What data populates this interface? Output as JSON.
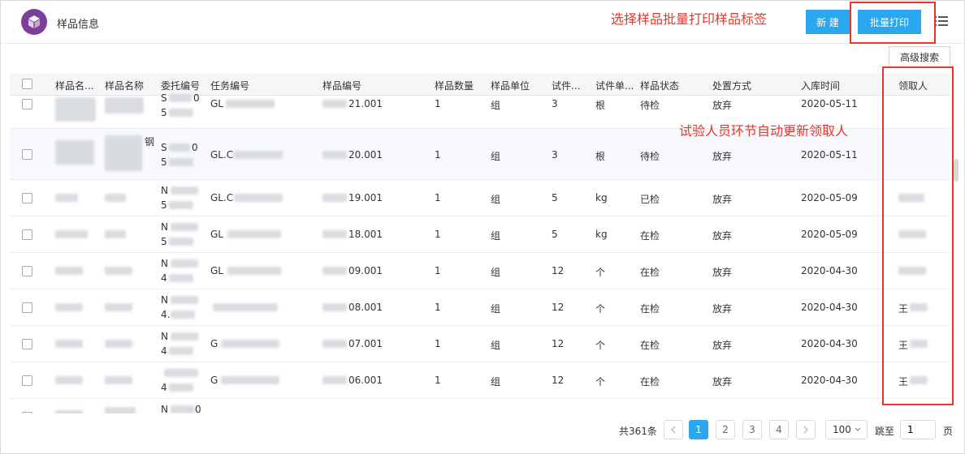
{
  "header": {
    "title": "样品信息",
    "logo_icon": "cube-icon",
    "new_label": "新 建",
    "batch_print_label": "批量打印",
    "menu_icon": "list-menu-icon",
    "annotation_top": "选择样品批量打印样品标签",
    "annotation_mid": "试验人员环节自动更新领取人"
  },
  "toolbar": {
    "advanced_search_label": "高级搜索"
  },
  "table": {
    "columns": [
      "样品名...",
      "样品名称",
      "委托编号",
      "任务编号",
      "样品编号",
      "样品数量",
      "样品单位",
      "试件...",
      "试件单...",
      "样品状态",
      "处置方式",
      "入库时间",
      "领取人"
    ],
    "rows": [
      {
        "order_prefix": "S",
        "order_suffix": "0",
        "order_line2": "5",
        "task_prefix": "GL",
        "sample_no_suffix": "21.001",
        "qty": "1",
        "unit": "组",
        "spec_count": "3",
        "spec_unit": "根",
        "status": "待检",
        "disposal": "放弃",
        "date": "2020-05-11",
        "receiver": ""
      },
      {
        "name2_extra": "钢",
        "order_prefix": "S",
        "order_suffix": "0",
        "order_line2": "5",
        "task_prefix": "GL.C",
        "sample_no_suffix": "20.001",
        "qty": "1",
        "unit": "组",
        "spec_count": "3",
        "spec_unit": "根",
        "status": "待检",
        "disposal": "放弃",
        "date": "2020-05-11",
        "receiver": ""
      },
      {
        "order_prefix": "N",
        "order_suffix": "",
        "order_line2": "5",
        "task_prefix": "GL.C",
        "sample_no_suffix": "19.001",
        "qty": "1",
        "unit": "组",
        "spec_count": "5",
        "spec_unit": "kg",
        "status": "已检",
        "disposal": "放弃",
        "date": "2020-05-09",
        "receiver": ""
      },
      {
        "order_prefix": "N",
        "order_suffix": "",
        "order_line2": "5",
        "task_prefix": "GL",
        "sample_no_suffix": "18.001",
        "qty": "1",
        "unit": "组",
        "spec_count": "5",
        "spec_unit": "kg",
        "status": "在检",
        "disposal": "放弃",
        "date": "2020-05-09",
        "receiver": ""
      },
      {
        "order_prefix": "N",
        "order_suffix": "",
        "order_line2": "4",
        "task_prefix": "GL",
        "sample_no_suffix": "09.001",
        "qty": "1",
        "unit": "组",
        "spec_count": "12",
        "spec_unit": "个",
        "status": "在检",
        "disposal": "放弃",
        "date": "2020-04-30",
        "receiver": ""
      },
      {
        "order_prefix": "N",
        "order_suffix": "",
        "order_line2": "4.",
        "task_prefix": "",
        "sample_no_suffix": "08.001",
        "qty": "1",
        "unit": "组",
        "spec_count": "12",
        "spec_unit": "个",
        "status": "在检",
        "disposal": "放弃",
        "date": "2020-04-30",
        "receiver": "王"
      },
      {
        "order_prefix": "N",
        "order_suffix": "",
        "order_line2": "4",
        "task_prefix": "G",
        "sample_no_suffix": "07.001",
        "qty": "1",
        "unit": "组",
        "spec_count": "12",
        "spec_unit": "个",
        "status": "在检",
        "disposal": "放弃",
        "date": "2020-04-30",
        "receiver": "王"
      },
      {
        "order_prefix": "",
        "order_suffix": "",
        "order_line2": "4",
        "task_prefix": "G",
        "sample_no_suffix": "06.001",
        "qty": "1",
        "unit": "组",
        "spec_count": "12",
        "spec_unit": "个",
        "status": "在检",
        "disposal": "放弃",
        "date": "2020-04-30",
        "receiver": "王"
      },
      {
        "order_prefix": "N",
        "order_suffix": "0",
        "order_line2": "",
        "task_prefix": "",
        "sample_no_suffix": "",
        "qty": "",
        "unit": "",
        "spec_count": "",
        "spec_unit": "",
        "status": "",
        "disposal": "",
        "date": "",
        "receiver": ""
      }
    ]
  },
  "pagination": {
    "total_label": "共361条",
    "pages": [
      "1",
      "2",
      "3",
      "4"
    ],
    "active_page": "1",
    "prev_icon": "chevron-left-icon",
    "next_icon": "chevron-right-icon",
    "page_size": "100",
    "jump_label": "跳至",
    "jump_value": "1",
    "page_label": "页"
  },
  "colors": {
    "accent": "#2aa7ee",
    "annotation": "#e8352b",
    "logo": "#7b3f9a"
  }
}
